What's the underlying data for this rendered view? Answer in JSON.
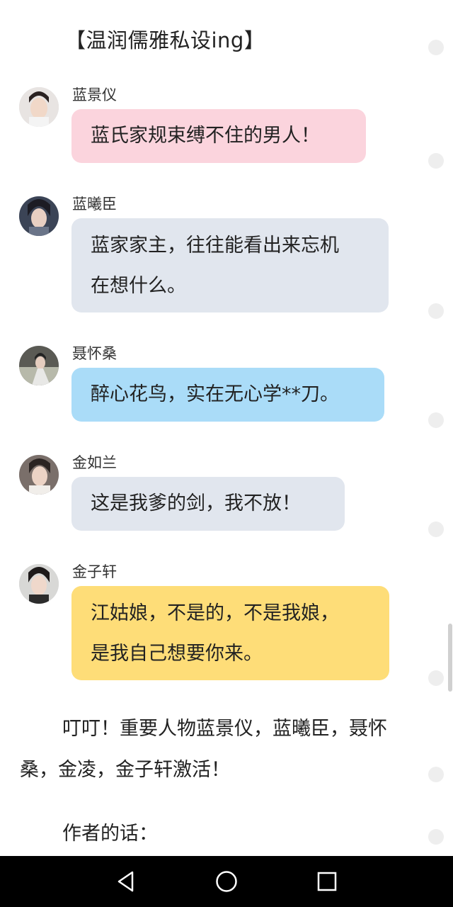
{
  "header": {
    "title": "【温润儒雅私设ing】"
  },
  "messages": [
    {
      "sender": "蓝景仪",
      "text": "蓝氏家规束缚不住的男人！",
      "color": "#fbd4dd"
    },
    {
      "sender": "蓝曦臣",
      "text": "蓝家家主，往往能看出来忘机\n在想什么。",
      "color": "#e1e6ee"
    },
    {
      "sender": "聂怀桑",
      "text": "醉心花鸟，实在无心学**刀。",
      "color": "#aadcf8"
    },
    {
      "sender": "金如兰",
      "text": "这是我爹的剑，我不放！",
      "color": "#e1e6ee"
    },
    {
      "sender": "金子轩",
      "text": "江姑娘，不是的，不是我娘，\n是我自己想要你来。",
      "color": "#fedd78"
    }
  ],
  "narration": "叮叮！重要人物蓝景仪，蓝曦臣，聂怀桑，金凌，金子轩激活！",
  "author_note": "作者的话：",
  "nav": {
    "back": "back-icon",
    "home": "home-icon",
    "recents": "recents-icon"
  }
}
